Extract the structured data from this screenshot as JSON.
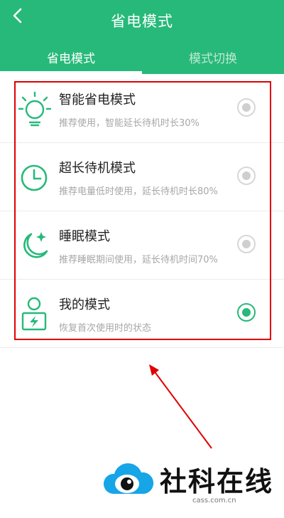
{
  "header": {
    "title": "省电模式",
    "back_icon": "chevron-left-icon",
    "tabs": [
      {
        "label": "省电模式",
        "active": true
      },
      {
        "label": "模式切换",
        "active": false
      }
    ]
  },
  "modes": [
    {
      "name": "智能省电模式",
      "desc": "推荐使用，智能延长待机时长30%",
      "icon": "lightbulb-icon",
      "selected": false
    },
    {
      "name": "超长待机模式",
      "desc": "推荐电量低时使用，延长待机时长80%",
      "icon": "clock-icon",
      "selected": false
    },
    {
      "name": "睡眠模式",
      "desc": "推荐睡眠期间使用，延长待机时间70%",
      "icon": "moon-icon",
      "selected": false
    },
    {
      "name": "我的模式",
      "desc": "恢复首次使用时的状态",
      "icon": "user-battery-icon",
      "selected": true
    }
  ],
  "watermark": {
    "brand": "社科在线",
    "domain": "cass.com.cn"
  },
  "colors": {
    "accent": "#27b97a",
    "highlight_box": "#e00000",
    "arrow": "#e00000"
  }
}
